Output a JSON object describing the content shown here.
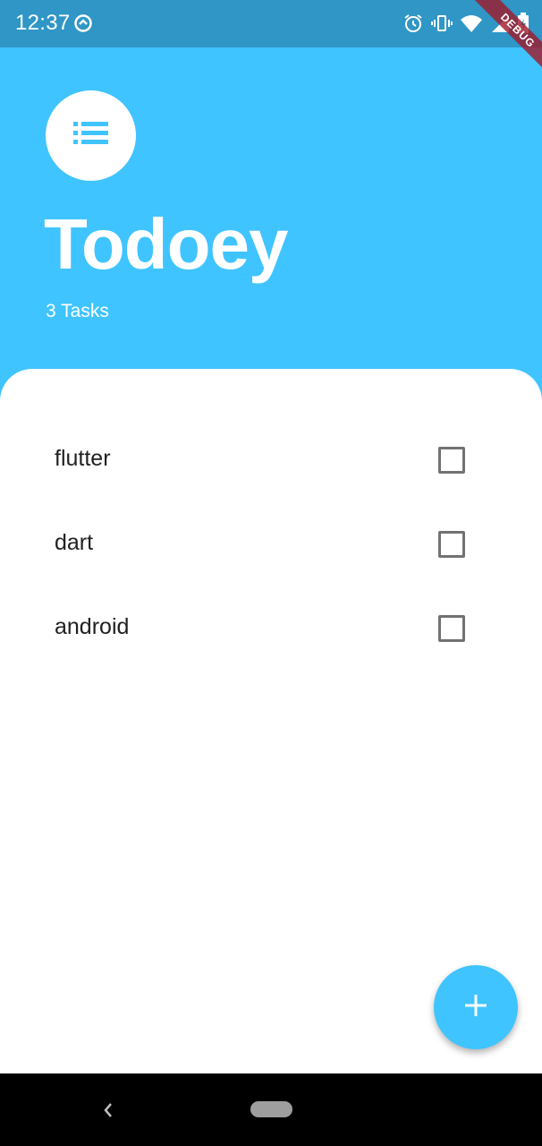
{
  "status_bar": {
    "time": "12:37",
    "left_icon": "sync-icon",
    "right_icons": [
      "alarm-icon",
      "vibrate-icon",
      "wifi-icon",
      "signal-icon",
      "battery-charging-icon"
    ]
  },
  "debug_banner": {
    "label": "DEBUG"
  },
  "header": {
    "avatar_icon": "list-icon",
    "title": "Todoey",
    "task_count": "3 Tasks"
  },
  "tasks": [
    {
      "label": "flutter",
      "checked": false
    },
    {
      "label": "dart",
      "checked": false
    },
    {
      "label": "android",
      "checked": false
    }
  ],
  "fab": {
    "icon": "add-icon"
  },
  "nav_bar": {
    "back_icon": "back-chevron-icon",
    "home_icon": "home-pill-icon"
  },
  "colors": {
    "primary": "#40c4ff",
    "status_bar": "#3096c6",
    "panel": "#ffffff",
    "checkbox_border": "#727272"
  }
}
